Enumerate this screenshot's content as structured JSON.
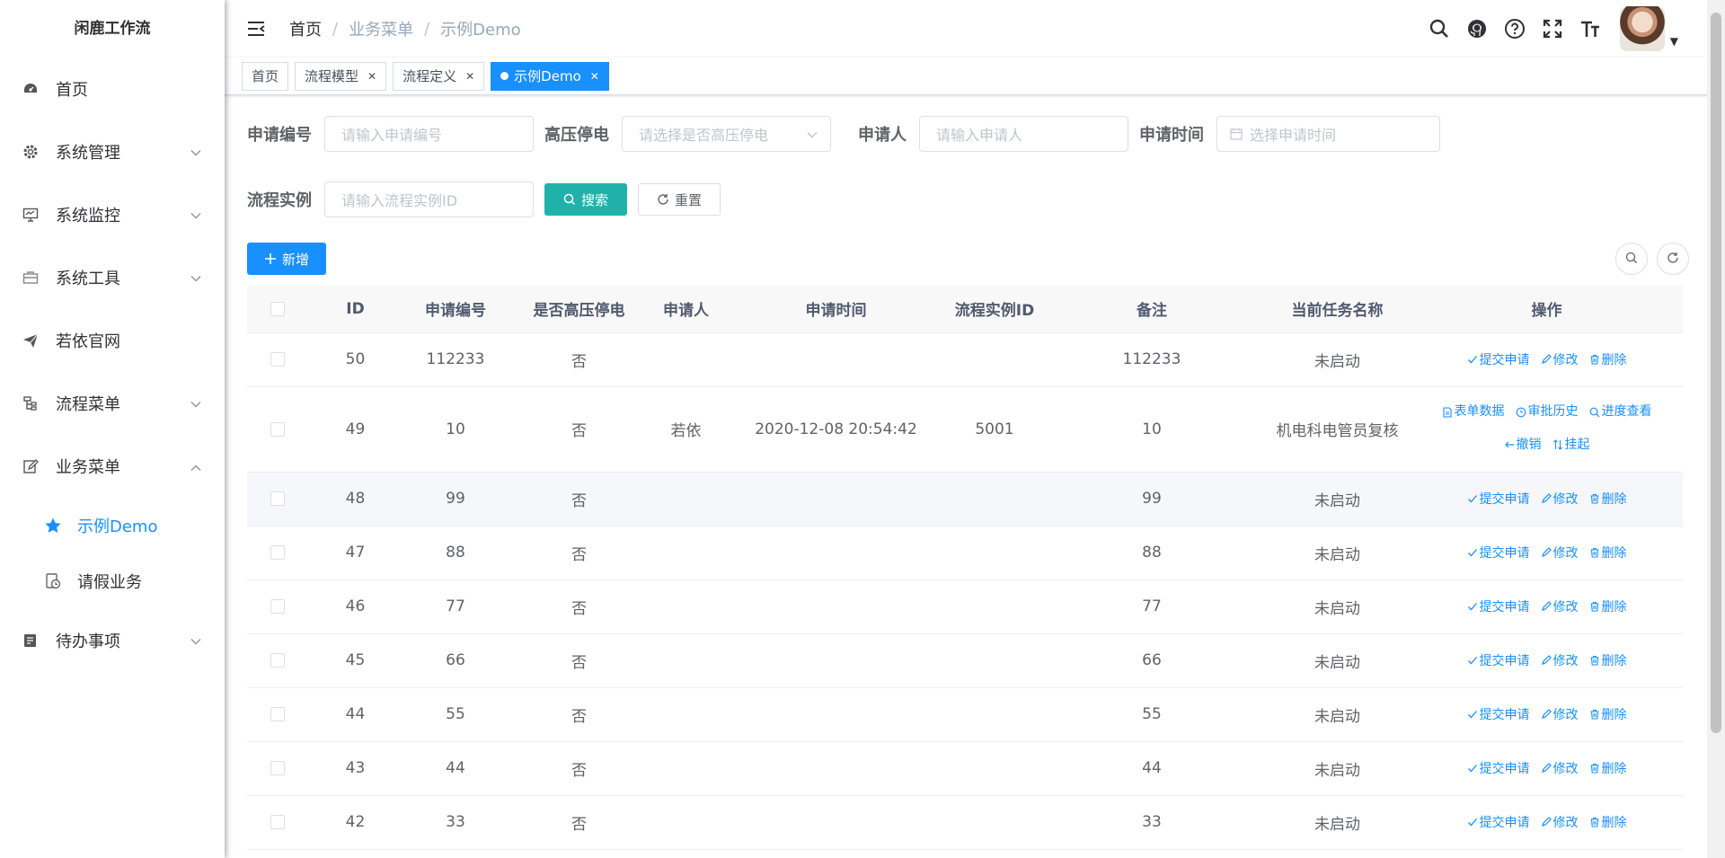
{
  "app": {
    "title": "闲鹿工作流"
  },
  "sidebar": {
    "items": [
      {
        "label": "首页",
        "icon": "dashboard-icon",
        "has_children": false
      },
      {
        "label": "系统管理",
        "icon": "gear-icon",
        "has_children": true
      },
      {
        "label": "系统监控",
        "icon": "monitor-icon",
        "has_children": true
      },
      {
        "label": "系统工具",
        "icon": "toolbox-icon",
        "has_children": true
      },
      {
        "label": "若依官网",
        "icon": "send-icon",
        "has_children": false
      },
      {
        "label": "流程菜单",
        "icon": "tree-icon",
        "has_children": true
      },
      {
        "label": "业务菜单",
        "icon": "edit-icon",
        "has_children": true,
        "expanded": true
      },
      {
        "label": "待办事项",
        "icon": "todo-icon",
        "has_children": true
      }
    ],
    "submenu": [
      {
        "label": "示例Demo",
        "icon": "star-icon",
        "active": true
      },
      {
        "label": "请假业务",
        "icon": "leave-icon",
        "active": false
      }
    ]
  },
  "breadcrumb": [
    "首页",
    "业务菜单",
    "示例Demo"
  ],
  "tags": [
    {
      "label": "首页",
      "closable": false,
      "active": false
    },
    {
      "label": "流程模型",
      "closable": true,
      "active": false
    },
    {
      "label": "流程定义",
      "closable": true,
      "active": false
    },
    {
      "label": "示例Demo",
      "closable": true,
      "active": true
    }
  ],
  "search_form": {
    "apply_no": {
      "label": "申请编号",
      "placeholder": "请输入申请编号"
    },
    "high_voltage": {
      "label": "高压停电",
      "placeholder": "请选择是否高压停电"
    },
    "applicant": {
      "label": "申请人",
      "placeholder": "请输入申请人"
    },
    "apply_time": {
      "label": "申请时间",
      "placeholder": "选择申请时间"
    },
    "instance": {
      "label": "流程实例",
      "placeholder": "请输入流程实例ID"
    },
    "search_label": "搜索",
    "reset_label": "重置"
  },
  "toolbar": {
    "add_label": "新增"
  },
  "table": {
    "columns": [
      "ID",
      "申请编号",
      "是否高压停电",
      "申请人",
      "申请时间",
      "流程实例ID",
      "备注",
      "当前任务名称",
      "操作"
    ],
    "rows": [
      {
        "id": "50",
        "no": "112233",
        "hv": "否",
        "applicant": "",
        "time": "",
        "instance": "",
        "remark": "112233",
        "task": "未启动"
      },
      {
        "id": "49",
        "no": "10",
        "hv": "否",
        "applicant": "若依",
        "time": "2020-12-08 20:54:42",
        "instance": "5001",
        "remark": "10",
        "task": "机电科电管员复核"
      },
      {
        "id": "48",
        "no": "99",
        "hv": "否",
        "applicant": "",
        "time": "",
        "instance": "",
        "remark": "99",
        "task": "未启动"
      },
      {
        "id": "47",
        "no": "88",
        "hv": "否",
        "applicant": "",
        "time": "",
        "instance": "",
        "remark": "88",
        "task": "未启动"
      },
      {
        "id": "46",
        "no": "77",
        "hv": "否",
        "applicant": "",
        "time": "",
        "instance": "",
        "remark": "77",
        "task": "未启动"
      },
      {
        "id": "45",
        "no": "66",
        "hv": "否",
        "applicant": "",
        "time": "",
        "instance": "",
        "remark": "66",
        "task": "未启动"
      },
      {
        "id": "44",
        "no": "55",
        "hv": "否",
        "applicant": "",
        "time": "",
        "instance": "",
        "remark": "55",
        "task": "未启动"
      },
      {
        "id": "43",
        "no": "44",
        "hv": "否",
        "applicant": "",
        "time": "",
        "instance": "",
        "remark": "44",
        "task": "未启动"
      },
      {
        "id": "42",
        "no": "33",
        "hv": "否",
        "applicant": "",
        "time": "",
        "instance": "",
        "remark": "33",
        "task": "未启动"
      }
    ],
    "actions_default": [
      "提交申请",
      "修改",
      "删除"
    ],
    "actions_started": [
      "表单数据",
      "审批历史",
      "进度查看",
      "撤销",
      "挂起"
    ]
  },
  "colors": {
    "primary": "#1890ff",
    "search": "#20b2aa",
    "text": "#606266"
  }
}
